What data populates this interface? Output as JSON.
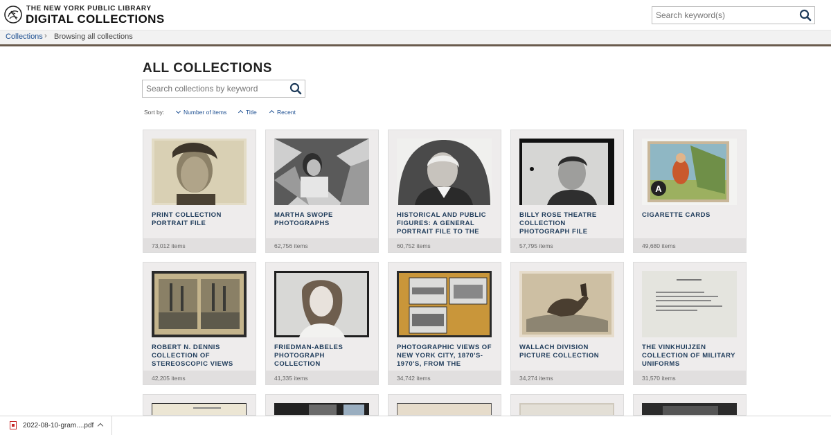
{
  "header": {
    "brand_top": "THE NEW YORK PUBLIC LIBRARY",
    "brand_main": "DIGITAL COLLECTIONS",
    "search_placeholder": "Search keyword(s)"
  },
  "breadcrumb": {
    "link": "Collections",
    "separator": "›",
    "current": "Browsing all collections"
  },
  "main": {
    "title": "ALL COLLECTIONS",
    "search_placeholder": "Search collections by keyword",
    "sort_label": "Sort by:",
    "sort_options": [
      "Number of items",
      "Title",
      "Recent"
    ]
  },
  "collections": [
    {
      "title": "PRINT COLLECTION PORTRAIT FILE",
      "count": "73,012 items"
    },
    {
      "title": "MARTHA SWOPE PHOTOGRAPHS",
      "count": "62,756 items"
    },
    {
      "title": "HISTORICAL AND PUBLIC FIGURES: A GENERAL PORTRAIT FILE TO THE",
      "count": "60,752 items"
    },
    {
      "title": "BILLY ROSE THEATRE COLLECTION PHOTOGRAPH FILE",
      "count": "57,795 items"
    },
    {
      "title": "CIGARETTE CARDS",
      "count": "49,680 items"
    },
    {
      "title": "ROBERT N. DENNIS COLLECTION OF STEREOSCOPIC VIEWS",
      "count": "42,205 items"
    },
    {
      "title": "FRIEDMAN-ABELES PHOTOGRAPH COLLECTION",
      "count": "41,335 items"
    },
    {
      "title": "PHOTOGRAPHIC VIEWS OF NEW YORK CITY, 1870'S-1970'S, FROM THE",
      "count": "34,742 items"
    },
    {
      "title": "WALLACH DIVISION PICTURE COLLECTION",
      "count": "34,274 items"
    },
    {
      "title": "THE VINKHUIJZEN COLLECTION OF MILITARY UNIFORMS",
      "count": "31,570 items"
    }
  ],
  "download": {
    "filename": "2022-08-10-gram....pdf"
  },
  "colors": {
    "link": "#1d4f91",
    "card_title": "#1e3b5a",
    "card_bg": "#eeecec",
    "header_rule": "#6a5b4d"
  }
}
